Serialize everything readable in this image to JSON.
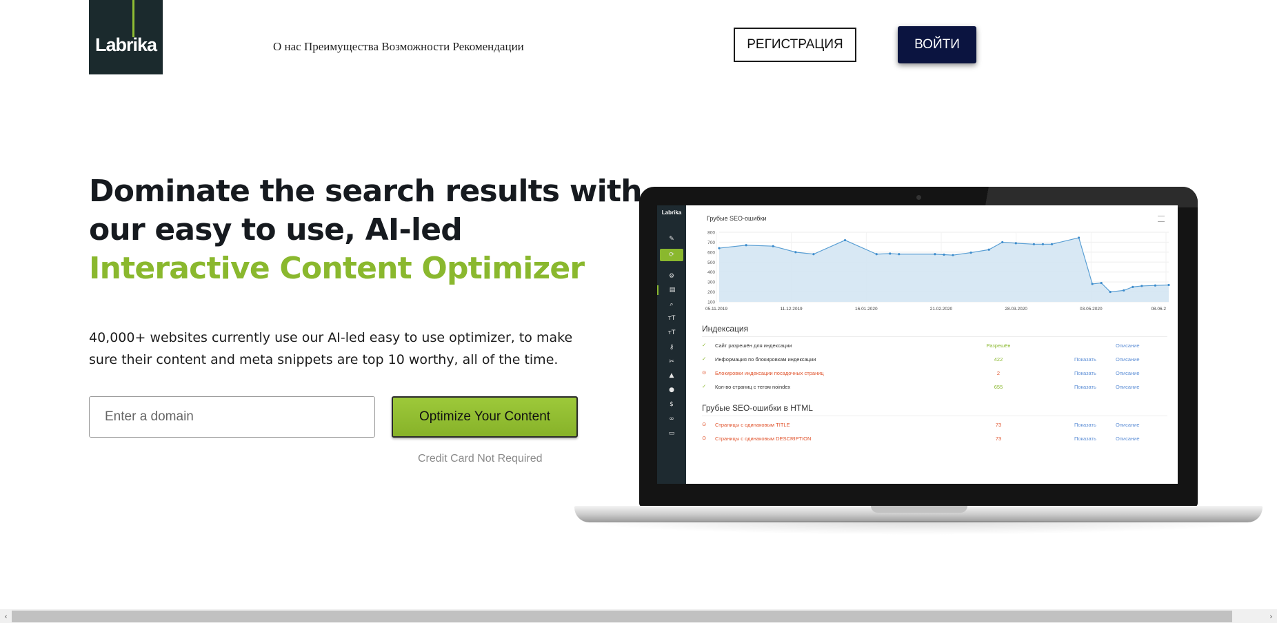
{
  "header": {
    "logo_text": "Labrika",
    "nav": [
      "О нас",
      "Преимущества",
      "Возможности",
      "Рекомендации"
    ],
    "register_label": "РЕГИСТРАЦИЯ",
    "login_label": "ВОЙТИ"
  },
  "hero": {
    "headline_line1": "Dominate the search results with",
    "headline_line2": "our easy to use, AI-led",
    "headline_line3": "Interactive Content Optimizer",
    "description_line1": "40,000+ websites currently use our AI-led easy to use optimizer, to make",
    "description_line2": "sure their content and meta snippets are top 10 worthy, all of the time.",
    "domain_placeholder": "Enter a domain",
    "cta_label": "Optimize Your Content",
    "credit_note": "Credit Card Not Required"
  },
  "screen": {
    "logo_text": "Labrika",
    "chart_title": "Грубые SEO-ошибки",
    "indexing_title": "Индексация",
    "indexing_rows": [
      {
        "label": "Сайт разрешён для индексации",
        "value": "Разрешён",
        "show": "",
        "desc": "Описание",
        "status": "ok"
      },
      {
        "label": "Информация по блокировкам индексации",
        "value": "422",
        "show": "Показать",
        "desc": "Описание",
        "status": "ok"
      },
      {
        "label": "Блокировки индексации посадочных страниц",
        "value": "2",
        "show": "Показать",
        "desc": "Описание",
        "status": "err"
      },
      {
        "label": "Кол-во страниц с тегом noindex",
        "value": "655",
        "show": "Показать",
        "desc": "Описание",
        "status": "ok"
      }
    ],
    "html_title": "Грубые SEO-ошибки в HTML",
    "html_rows": [
      {
        "label": "Страницы с одинаковым TITLE",
        "value": "73",
        "show": "Показать",
        "desc": "Описание",
        "status": "err"
      },
      {
        "label": "Страницы с одинаковым DESCRIPTION",
        "value": "73",
        "show": "Показать",
        "desc": "Описание",
        "status": "err"
      }
    ]
  },
  "chart_data": {
    "type": "area",
    "title": "Грубые SEO-ошибки",
    "xlabel": "",
    "ylabel": "",
    "y_ticks": [
      100,
      200,
      300,
      400,
      500,
      600,
      700,
      800
    ],
    "ylim": [
      100,
      800
    ],
    "x_ticks": [
      "05.11.2019",
      "11.12.2019",
      "16.01.2020",
      "21.02.2020",
      "28.03.2020",
      "03.05.2020",
      "08.06.2"
    ],
    "series": [
      {
        "x": [
          0,
          0.06,
          0.12,
          0.17,
          0.21,
          0.28,
          0.35,
          0.38,
          0.4,
          0.48,
          0.5,
          0.52,
          0.56,
          0.6,
          0.63,
          0.66,
          0.7,
          0.72,
          0.74,
          0.8,
          0.83,
          0.85,
          0.87,
          0.9,
          0.92,
          0.94,
          0.97,
          1.0
        ],
        "values": [
          640,
          670,
          660,
          600,
          580,
          720,
          580,
          585,
          580,
          580,
          575,
          570,
          595,
          625,
          700,
          690,
          680,
          680,
          680,
          745,
          280,
          290,
          200,
          215,
          250,
          260,
          265,
          270
        ]
      }
    ],
    "grid": true,
    "legend": "none"
  }
}
